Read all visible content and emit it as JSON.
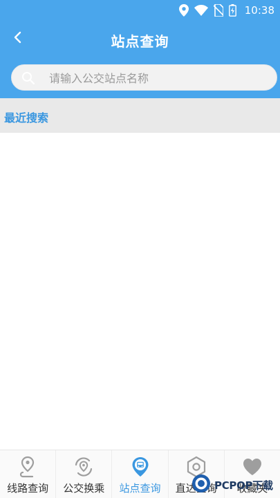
{
  "status_bar": {
    "time": "10:38",
    "icons": [
      "location-icon",
      "wifi-icon",
      "no-sim-icon",
      "battery-charging-icon"
    ]
  },
  "header": {
    "title": "站点查询",
    "back_icon": "chevron-left-icon"
  },
  "search": {
    "placeholder": "请输入公交站点名称",
    "value": "",
    "icon": "search-icon"
  },
  "recent": {
    "label": "最近搜索",
    "items": []
  },
  "tabs": [
    {
      "label": "线路查询",
      "icon": "route-pin-icon",
      "active": false
    },
    {
      "label": "公交换乘",
      "icon": "transfer-icon",
      "active": false
    },
    {
      "label": "站点查询",
      "icon": "bus-stop-icon",
      "active": true
    },
    {
      "label": "直达查询",
      "icon": "direct-hexagon-icon",
      "active": false
    },
    {
      "label": "收藏夹",
      "icon": "heart-icon",
      "active": false
    }
  ],
  "watermark": {
    "text": "PCPOP下载"
  },
  "colors": {
    "brand_blue": "#4aa6ec",
    "active_tab": "#3a97e0",
    "recent_bg": "#e9e9e9",
    "inactive_icon": "#9e9e9e"
  }
}
